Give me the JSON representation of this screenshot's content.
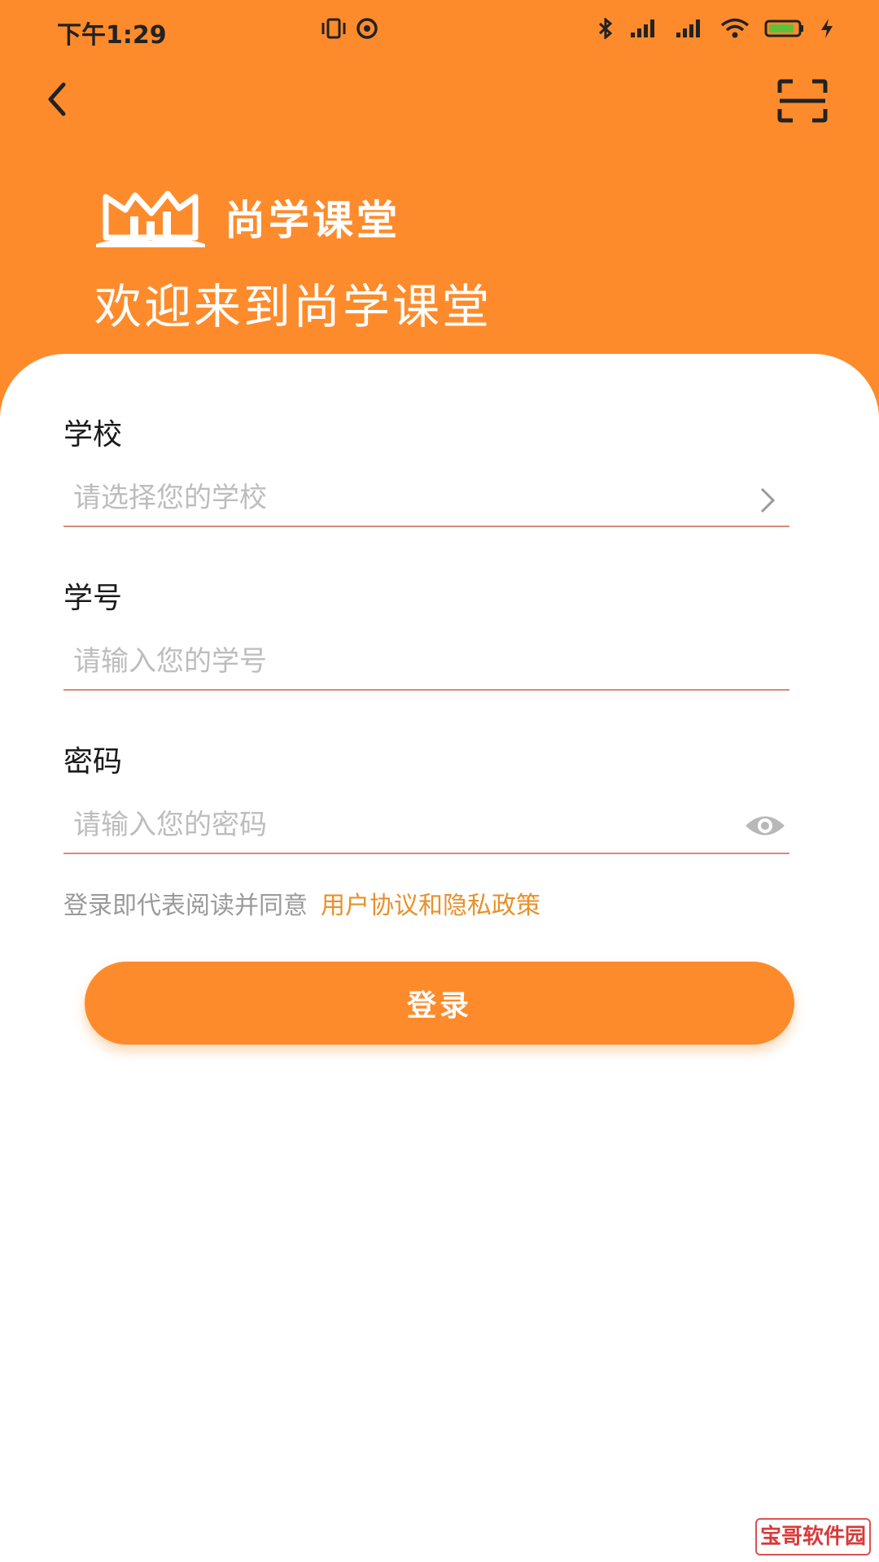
{
  "status_bar": {
    "time": "下午1:29"
  },
  "header": {
    "brand_name": "尚学课堂",
    "welcome_text": "欢迎来到尚学课堂",
    "accent_color": "#fd8b2c"
  },
  "form": {
    "school": {
      "label": "学校",
      "placeholder": "请选择您的学校"
    },
    "student_id": {
      "label": "学号",
      "placeholder": "请输入您的学号"
    },
    "password": {
      "label": "密码",
      "placeholder": "请输入您的密码"
    }
  },
  "agreement": {
    "prefix": "登录即代表阅读并同意",
    "link": "用户协议和隐私政策"
  },
  "login_button": {
    "label": "登录"
  },
  "watermark": {
    "text": "宝哥软件园"
  }
}
